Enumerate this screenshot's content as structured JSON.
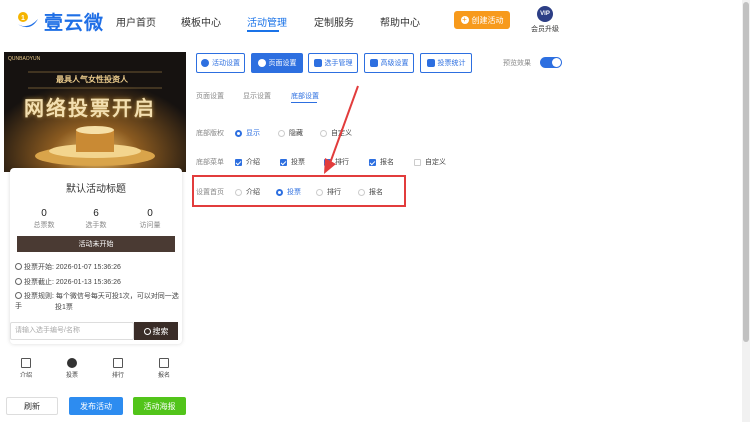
{
  "header": {
    "logo_text": "壹云微",
    "nav": [
      "用户首页",
      "模板中心",
      "活动管理",
      "定制服务",
      "帮助中心"
    ],
    "active_nav": "活动管理",
    "create_label": "创建活动",
    "vip_badge": "VIP",
    "vip_label": "会员升级"
  },
  "preview": {
    "banner": {
      "brand": "QUNBAOYUN",
      "subtitle": "最具人气女性投资人",
      "title": "网络投票开启"
    },
    "card": {
      "title": "默认活动标题",
      "stats": [
        {
          "value": "0",
          "label": "总票数"
        },
        {
          "value": "6",
          "label": "选手数"
        },
        {
          "value": "0",
          "label": "访问量"
        }
      ],
      "status": "活动未开始",
      "info": [
        "投票开始: 2026-01-07 15:36:26",
        "投票截止: 2026-01-13 15:36:26",
        "投票规则: 每个微信号每天可投1次，可以对同一选手",
        "投1票"
      ],
      "search_placeholder": "请输入选手编号/名称",
      "search_label": "搜索"
    },
    "tabbar": [
      "介绍",
      "投票",
      "排行",
      "报名"
    ],
    "buttons": {
      "refresh": "刷新",
      "publish": "发布活动",
      "poster": "活动海报"
    }
  },
  "toolbar": {
    "items": [
      "活动设置",
      "页面设置",
      "选手管理",
      "高级设置",
      "投票统计"
    ],
    "active": "页面设置",
    "preview_label": "预览效果",
    "preview_on": true
  },
  "subtabs": [
    "页面设置",
    "显示设置",
    "底部设置"
  ],
  "active_subtab": "底部设置",
  "settings": {
    "copyright": {
      "label": "底部版权",
      "options": [
        "显示",
        "隐藏",
        "自定义"
      ],
      "selected": "显示"
    },
    "menu": {
      "label": "底部菜单",
      "options": [
        "介绍",
        "投票",
        "排行",
        "报名",
        "自定义"
      ],
      "checked": [
        "介绍",
        "投票",
        "排行",
        "报名"
      ]
    },
    "home": {
      "label": "设置首页",
      "options": [
        "介绍",
        "投票",
        "排行",
        "报名"
      ],
      "selected": "投票"
    }
  },
  "colors": {
    "primary": "#2d6fe0",
    "orange": "#f79a1c",
    "green": "#52c41a",
    "annotation": "#e23c3c"
  }
}
